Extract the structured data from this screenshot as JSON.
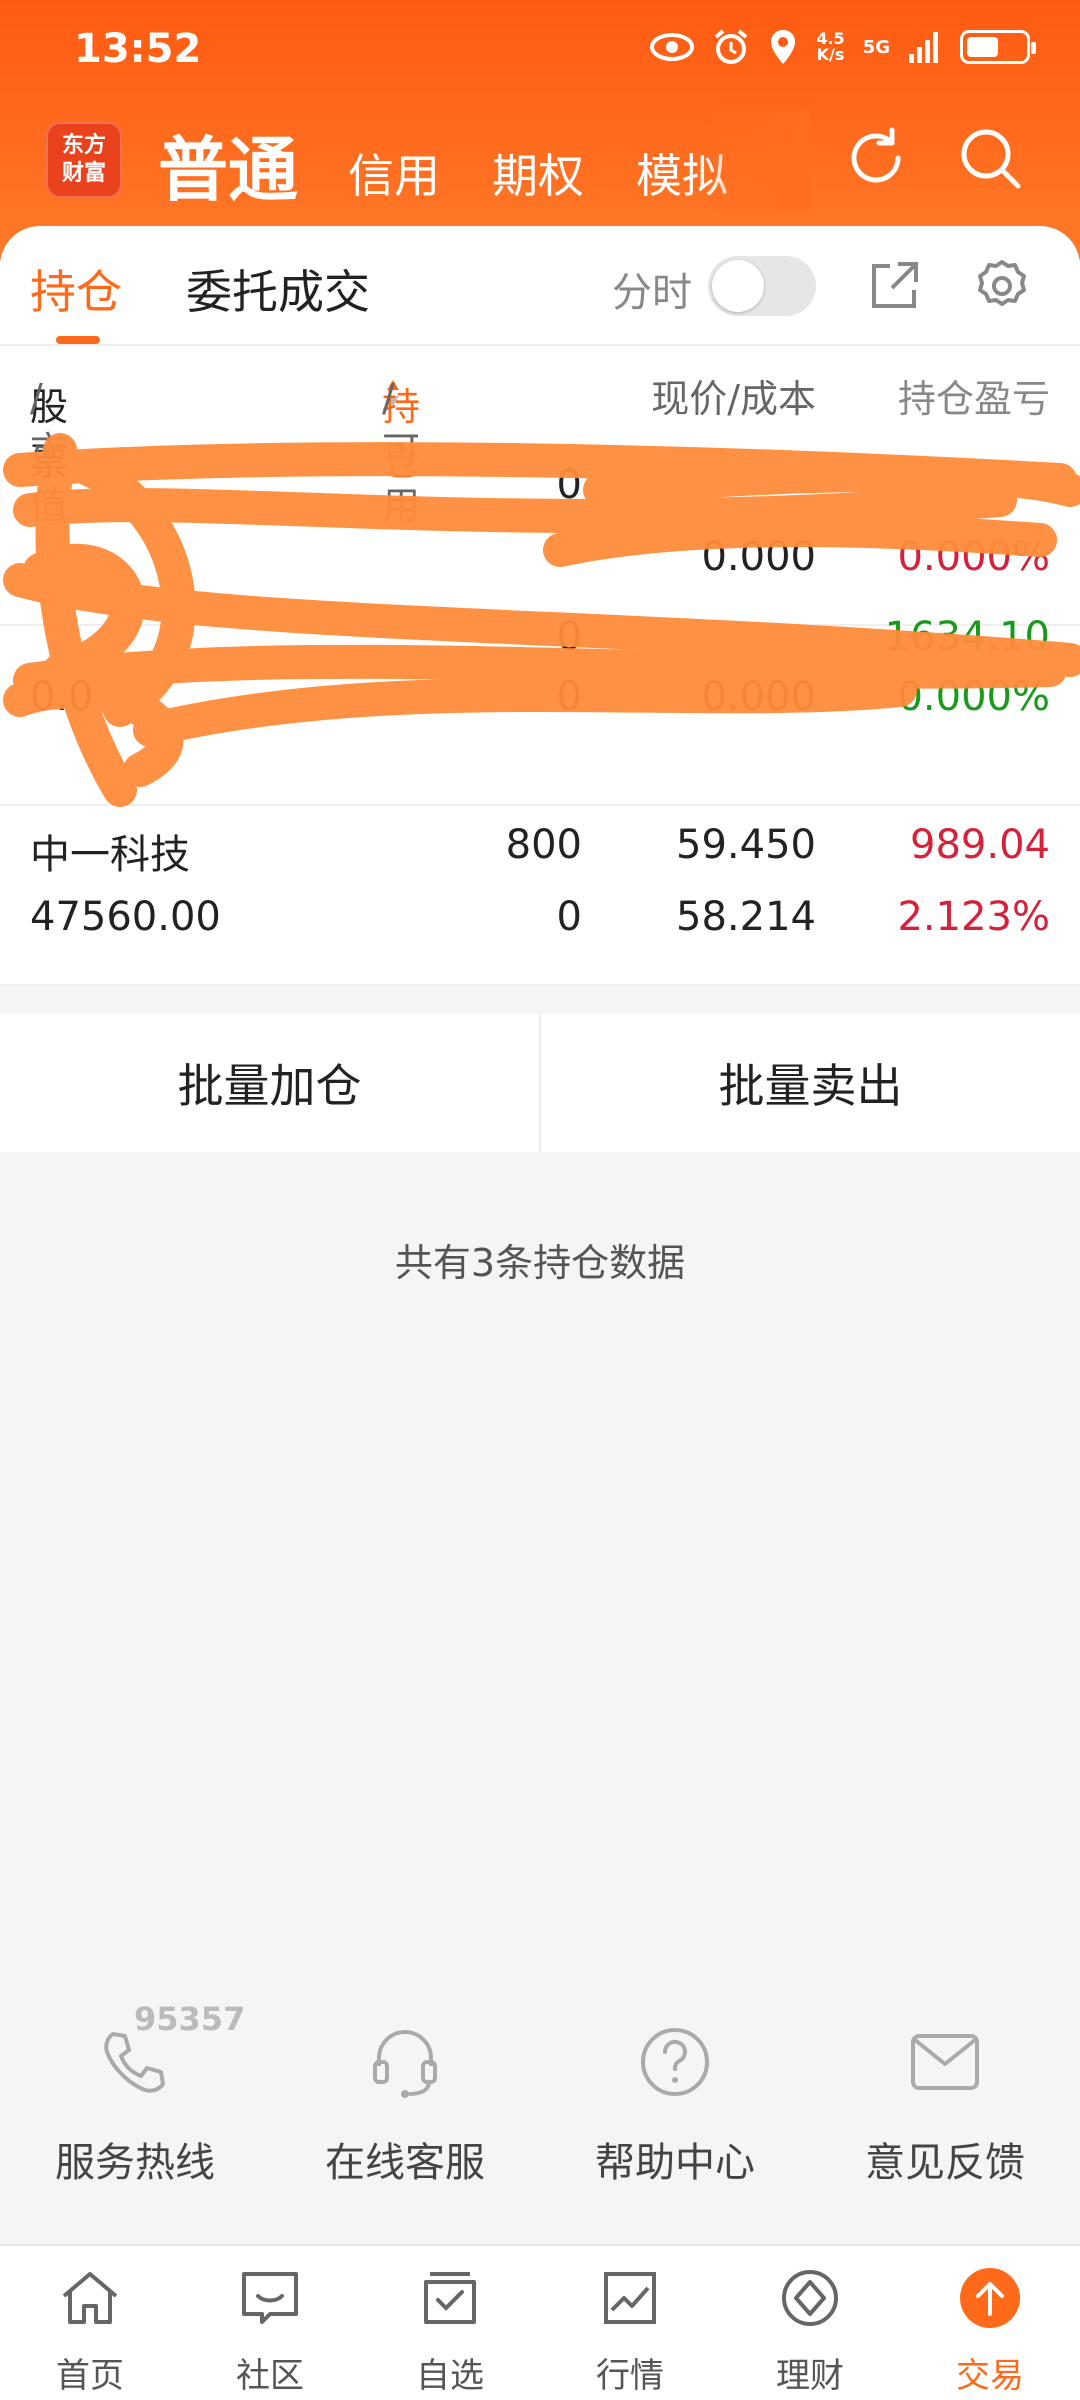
{
  "status_bar": {
    "time": "13:52",
    "net_speed_top": "4.5",
    "net_speed_bottom": "K/s",
    "network": "5G",
    "battery_level": 0.55
  },
  "logo_text": "东方\n财富",
  "account_tabs": [
    "普通",
    "信用",
    "期权",
    "模拟"
  ],
  "card_tabs": {
    "active": "持仓",
    "other": "委托成交"
  },
  "fenshi_label": "分时",
  "columns": {
    "stock": "股票",
    "market_value": "/市值",
    "hold": "持仓",
    "available": "/可用",
    "price_cost": "现价/成本",
    "pnl": "持仓盈亏"
  },
  "positions": [
    {
      "name": "",
      "market_value": "",
      "hold": "0",
      "available": "",
      "price": "",
      "cost": "0.000",
      "pnl": "",
      "pnl_pct": "0.000%",
      "color": "red"
    },
    {
      "name": "",
      "market_value": "0.0",
      "hold": "0",
      "available": "0",
      "price": "",
      "cost": "0.000",
      "pnl": "1634.10",
      "pnl_pct": "0.000%",
      "color": "green"
    },
    {
      "name": "中一科技",
      "market_value": "47560.00",
      "hold": "800",
      "available": "0",
      "price": "59.450",
      "cost": "58.214",
      "pnl": "989.04",
      "pnl_pct": "2.123%",
      "color": "red"
    }
  ],
  "batch": {
    "add": "批量加仓",
    "sell": "批量卖出"
  },
  "summary": "共有3条持仓数据",
  "service": {
    "hotline_number": "95357",
    "items": [
      "服务热线",
      "在线客服",
      "帮助中心",
      "意见反馈"
    ]
  },
  "nav": [
    "首页",
    "社区",
    "自选",
    "行情",
    "理财",
    "交易"
  ],
  "colors": {
    "brand_orange": "#ff6a1a",
    "up_red": "#d6213a",
    "down_green": "#1a9a1a"
  }
}
